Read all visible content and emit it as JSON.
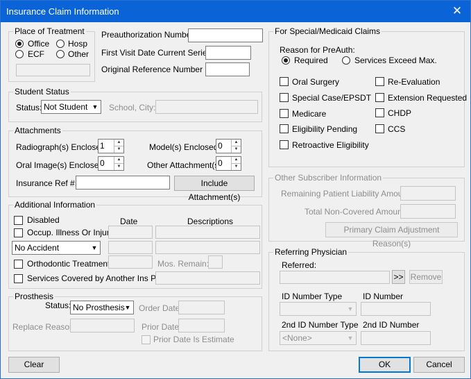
{
  "window": {
    "title": "Insurance Claim Information",
    "close_glyph": "✕"
  },
  "place_of_treatment": {
    "caption": "Place of Treatment",
    "options": [
      "Office",
      "Hosp",
      "ECF",
      "Other"
    ],
    "selected": "Office",
    "other_value": ""
  },
  "preauth": {
    "preauth_number_label": "Preauthorization Number:",
    "preauth_number_value": "",
    "first_visit_label": "First Visit Date Current Series:",
    "first_visit_value": "",
    "orig_ref_label": "Original Reference Number (#):",
    "orig_ref_value": ""
  },
  "student_status": {
    "caption": "Student Status",
    "status_label": "Status:",
    "status_value": "Not Student",
    "school_label": "School, City:",
    "school_value": ""
  },
  "attachments": {
    "caption": "Attachments",
    "radiographs_label": "Radiograph(s) Enclosed:",
    "radiographs_value": "1",
    "oral_images_label": "Oral Image(s) Enclosed:",
    "oral_images_value": "0",
    "models_label": "Model(s) Enclosed :",
    "models_value": "0",
    "other_label": "Other Attachment(s):",
    "other_value": "0",
    "ins_ref_label": "Insurance Ref #:",
    "ins_ref_value": "",
    "include_button": "Include Attachment(s)"
  },
  "additional": {
    "caption": "Additional Information",
    "disabled_label": "Disabled",
    "date_header": "Date",
    "desc_header": "Descriptions",
    "occup_label": "Occup. Illness Or Injury :",
    "accident_value": "No Accident",
    "ortho_label": "Orthodontic Treatment:",
    "mos_remain_label": "Mos. Remain:",
    "services_label": "Services Covered by Another Ins Plan:"
  },
  "prosthesis": {
    "caption": "Prosthesis",
    "status_label": "Status:",
    "status_value": "No Prosthesis",
    "order_date_label": "Order Date:",
    "replace_reason_label": "Replace Reason:",
    "prior_date_label": "Prior Date:",
    "prior_estimate_label": "Prior Date Is Estimate"
  },
  "special": {
    "caption": "For Special/Medicaid Claims",
    "reason_label": "Reason for PreAuth:",
    "reason_options": [
      "Required",
      "Services Exceed Max."
    ],
    "reason_selected": "Required",
    "left_checks": [
      "Oral Surgery",
      "Special Case/EPSDT",
      "Medicare",
      "Eligibility Pending",
      "Retroactive Eligibility"
    ],
    "right_checks": [
      "Re-Evaluation",
      "Extension Requested",
      "CHDP",
      "CCS"
    ]
  },
  "other_subscriber": {
    "caption": "Other Subscriber Information",
    "remaining_label": "Remaining Patient Liability Amount:",
    "noncovered_label": "Total Non-Covered Amount:",
    "primary_button": "Primary Claim Adjustment Reason(s)"
  },
  "referring": {
    "caption": "Referring Physician",
    "referred_label": "Referred:",
    "browse_button": ">>",
    "remove_button": "Remove",
    "id_type_label": "ID Number Type",
    "id_number_label": "ID Number",
    "id2_type_label": "2nd ID Number Type",
    "id2_type_value": "<None>",
    "id2_number_label": "2nd ID Number"
  },
  "footer": {
    "clear": "Clear",
    "ok": "OK",
    "cancel": "Cancel"
  }
}
